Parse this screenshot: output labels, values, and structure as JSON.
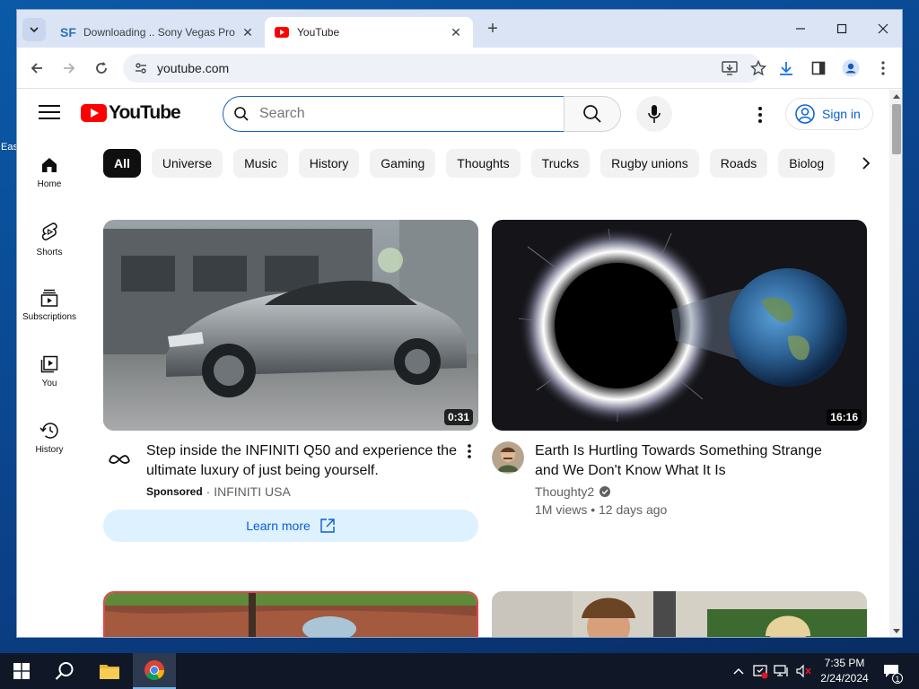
{
  "desktop": {
    "icon_label": "Eas"
  },
  "browser": {
    "tabs": [
      {
        "title": "Downloading .. Sony Vegas Pro",
        "favicon": "SF",
        "active": false
      },
      {
        "title": "YouTube",
        "favicon": "youtube-icon",
        "active": true
      }
    ],
    "url": "youtube.com"
  },
  "youtube": {
    "search_placeholder": "Search",
    "sign_in": "Sign in",
    "sidebar": [
      {
        "label": "Home",
        "icon": "home-icon"
      },
      {
        "label": "Shorts",
        "icon": "shorts-icon"
      },
      {
        "label": "Subscriptions",
        "icon": "subscriptions-icon"
      },
      {
        "label": "You",
        "icon": "you-icon"
      },
      {
        "label": "History",
        "icon": "history-icon"
      }
    ],
    "chips": [
      "All",
      "Universe",
      "Music",
      "History",
      "Gaming",
      "Thoughts",
      "Trucks",
      "Rugby unions",
      "Roads",
      "Biolog"
    ],
    "videos": [
      {
        "title": "Step inside the INFINITI Q50 and experience the ultimate luxury of just being yourself.",
        "duration": "0:31",
        "sponsored": "Sponsored",
        "channel": "INFINITI USA",
        "cta": "Learn more"
      },
      {
        "title": "Earth Is Hurtling Towards Something Strange and We Don't Know What It Is",
        "duration": "16:16",
        "channel": "Thoughty2",
        "stats": "1M views • 12 days ago"
      }
    ]
  },
  "taskbar": {
    "time": "7:35 PM",
    "date": "2/24/2024",
    "notification_count": "1"
  },
  "colors": {
    "accent": "#065fd4",
    "brand_red": "#ff0000",
    "taskbar": "#101827"
  }
}
